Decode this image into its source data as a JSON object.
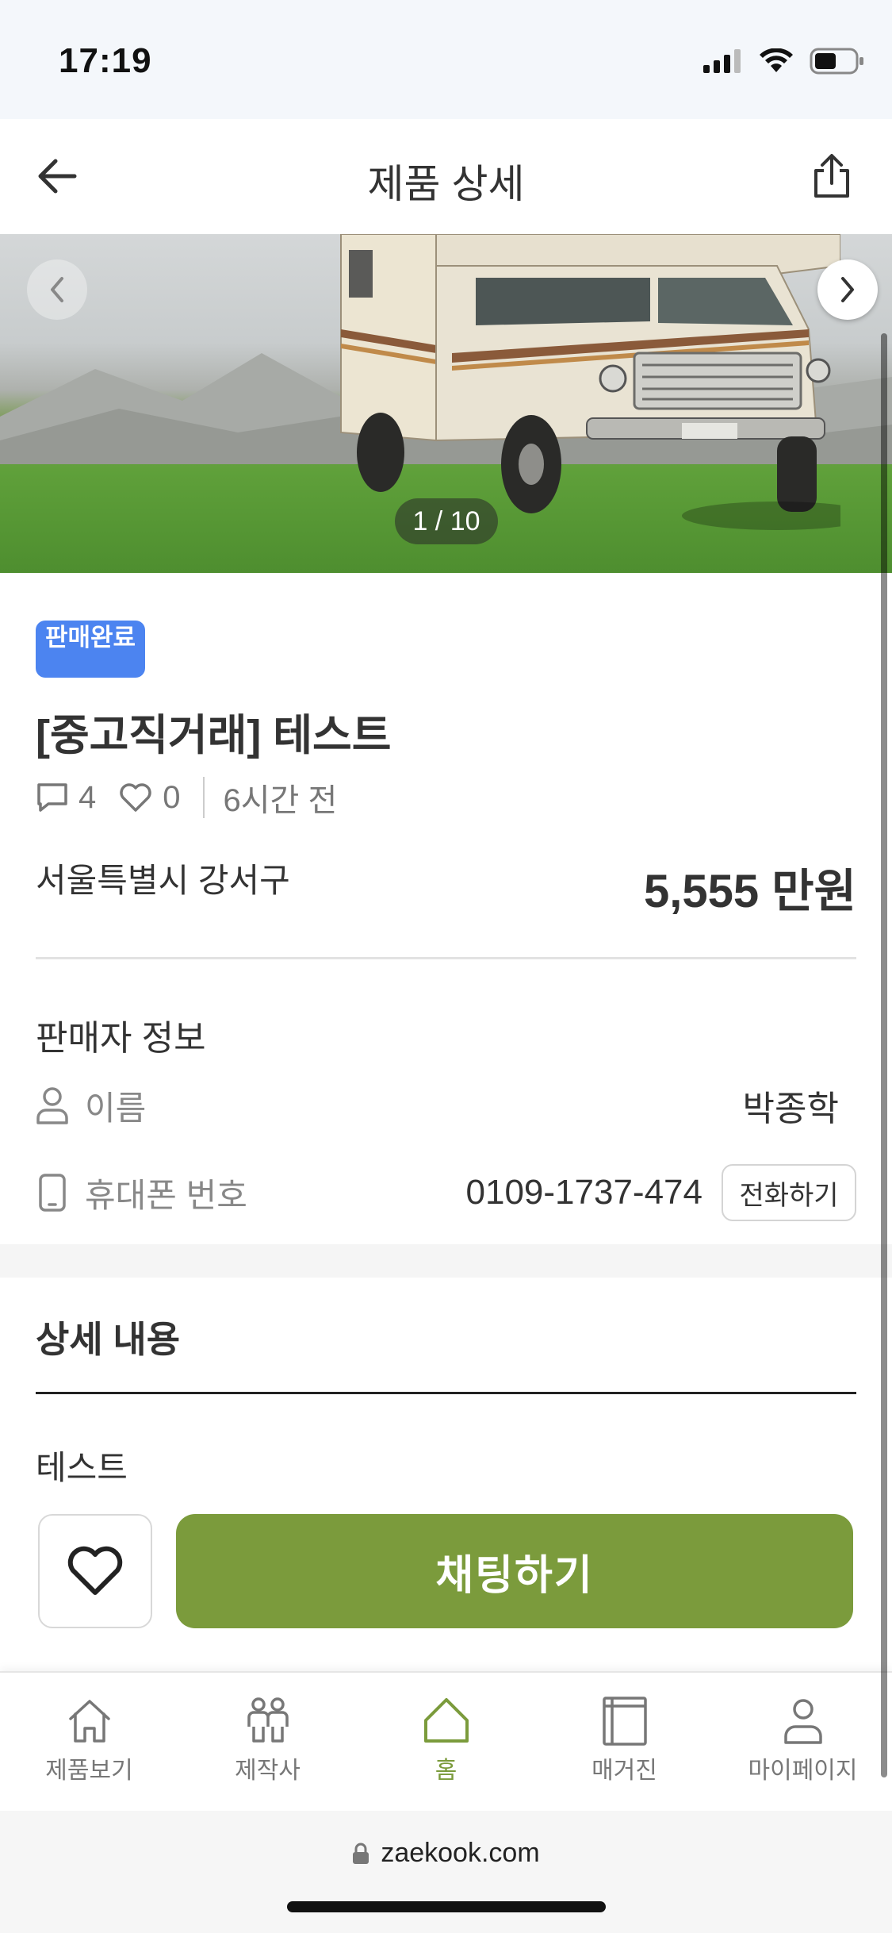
{
  "status_bar": {
    "time": "17:19",
    "icons": [
      "cellular-signal-icon",
      "wifi-icon",
      "battery-icon"
    ]
  },
  "header": {
    "title": "제품 상세",
    "back_icon": "arrow-left-icon",
    "share_icon": "share-icon"
  },
  "gallery": {
    "counter": "1 / 10",
    "prev_icon": "chevron-left-icon",
    "next_icon": "chevron-right-icon"
  },
  "product": {
    "status_badge": "판매완료",
    "title": "[중고직거래] 테스트",
    "comment_count": "4",
    "like_count": "0",
    "posted_ago": "6시간 전",
    "location": "서울특별시 강서구",
    "price": "5,555 만원"
  },
  "seller": {
    "heading": "판매자 정보",
    "name_label": "이름",
    "name_value": "박종학",
    "phone_label": "휴대폰 번호",
    "phone_value": "0109-1737-474",
    "call_button": "전화하기"
  },
  "details": {
    "heading": "상세 내용",
    "body": "테스트"
  },
  "actions": {
    "favorite_icon": "heart-icon",
    "chat_button": "채팅하기"
  },
  "bottom_nav": {
    "items": [
      {
        "label": "제품보기",
        "icon": "house-icon",
        "active": false
      },
      {
        "label": "제작사",
        "icon": "people-icon",
        "active": false
      },
      {
        "label": "홈",
        "icon": "home-icon",
        "active": true
      },
      {
        "label": "매거진",
        "icon": "magazine-icon",
        "active": false
      },
      {
        "label": "마이페이지",
        "icon": "person-icon",
        "active": false
      }
    ]
  },
  "browser": {
    "url": "zaekook.com"
  },
  "colors": {
    "accent": "#7b9b3c",
    "badge": "#4c84f0"
  }
}
